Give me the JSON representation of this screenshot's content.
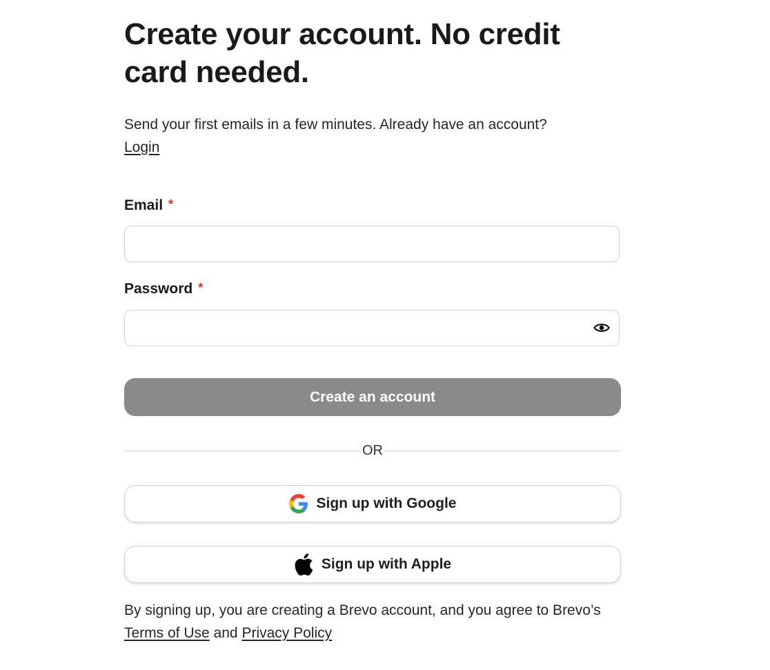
{
  "header": {
    "title": "Create your account. No credit card needed."
  },
  "intro": {
    "text": "Send your first emails in a few minutes. Already have an account?",
    "login_link": "Login"
  },
  "form": {
    "email_label": "Email",
    "email_required_mark": "*",
    "email_value": "",
    "password_label": "Password",
    "password_required_mark": "*",
    "password_value": "",
    "password_toggle_icon": "eye-icon",
    "submit_label": "Create an account",
    "submit_color": "#8a8a8a"
  },
  "divider": {
    "label": "OR"
  },
  "social": {
    "google_label": "Sign up with Google",
    "google_icon": "google-icon",
    "apple_label": "Sign up with Apple",
    "apple_icon": "apple-icon"
  },
  "legal": {
    "text_before": "By signing up, you are creating a Brevo account, and you agree to Brevo’s",
    "terms_link": "Terms of Use",
    "conjunction": "and",
    "privacy_link": "Privacy Policy"
  },
  "colors": {
    "required": "#d93025",
    "text": "#1f1f1f",
    "border": "#d2d2d2"
  }
}
